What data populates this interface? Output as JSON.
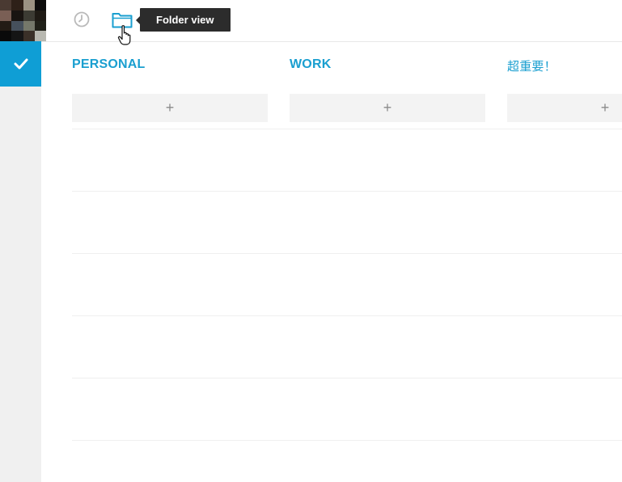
{
  "toolbar": {
    "buttons": [
      {
        "name": "clock",
        "icon": "clock-icon"
      },
      {
        "name": "folder",
        "icon": "folder-icon"
      }
    ],
    "tooltip": "Folder view"
  },
  "sidebar": {
    "avatar_colors": [
      "#4a3a32",
      "#2e2018",
      "#9b9283",
      "#0c0c0c",
      "#7a5f55",
      "#191411",
      "#3c3b33",
      "#1e1a14",
      "#231b15",
      "#46505c",
      "#75786a",
      "#202018",
      "#0a0a0a",
      "#151515",
      "#3a3028",
      "#b8b8b0"
    ],
    "active_icon": "check-icon"
  },
  "board": {
    "columns": [
      {
        "title": "PERSONAL",
        "add_label": "+"
      },
      {
        "title": "WORK",
        "add_label": "+"
      },
      {
        "title": "超重要！",
        "add_label": "+"
      }
    ]
  },
  "colors": {
    "accent": "#1a9fd0",
    "sidebar_active": "#0f9ed5",
    "tooltip_bg": "#2c2c2c"
  }
}
